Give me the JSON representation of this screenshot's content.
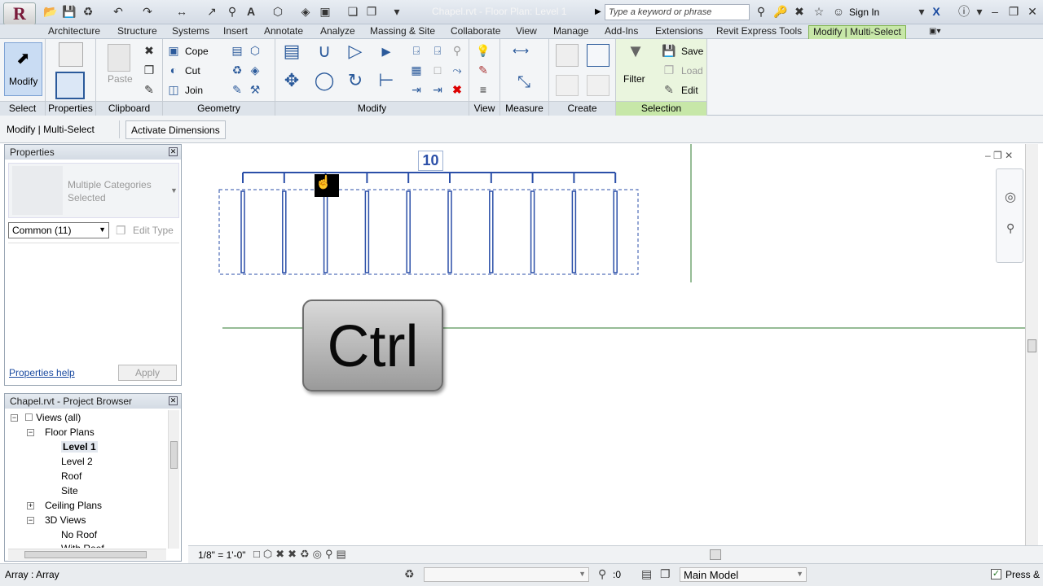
{
  "app": {
    "logo": "R",
    "document_title": "Chapel.rvt - Floor Plan: Level 1",
    "search_placeholder": "Type a keyword or phrase",
    "sign_in": "Sign In"
  },
  "tabs": [
    "Architecture",
    "Structure",
    "Systems",
    "Insert",
    "Annotate",
    "Analyze",
    "Massing & Site",
    "Collaborate",
    "View",
    "Manage",
    "Add-Ins",
    "Extensions",
    "Revit Express Tools",
    "Modify | Multi-Select"
  ],
  "ribbon": {
    "panels": {
      "select": "Select",
      "properties": "Properties",
      "clipboard": "Clipboard",
      "geometry": "Geometry",
      "modify": "Modify",
      "view": "View",
      "measure": "Measure",
      "create": "Create",
      "selection": "Selection"
    },
    "modify_label": "Modify",
    "paste_label": "Paste",
    "cope_label": "Cope",
    "cut_label": "Cut",
    "join_label": "Join",
    "filter_label": "Filter",
    "save_label": "Save",
    "load_label": "Load",
    "edit_label": "Edit"
  },
  "modebar": {
    "context": "Modify | Multi-Select",
    "activate_dimensions": "Activate Dimensions"
  },
  "properties": {
    "title": "Properties",
    "type_text": "Multiple Categories Selected",
    "filter_value": "Common (11)",
    "edit_type": "Edit Type",
    "help_link": "Properties help",
    "apply": "Apply"
  },
  "browser": {
    "title": "Chapel.rvt - Project Browser",
    "items": {
      "views_all": "Views (all)",
      "floor_plans": "Floor Plans",
      "level1": "Level 1",
      "level2": "Level 2",
      "roof": "Roof",
      "site": "Site",
      "ceiling_plans": "Ceiling Plans",
      "views_3d": "3D Views",
      "no_roof": "No Roof",
      "with_roof": "With Roof"
    }
  },
  "canvas": {
    "array_count": "10",
    "overlay_key": "Ctrl"
  },
  "viewbar": {
    "scale": "1/8\" = 1'-0\""
  },
  "status": {
    "text": "Array : Array",
    "selection_count": ":0",
    "workset": "Main Model",
    "press_drag": "Press &"
  },
  "colors": {
    "accent_tab": "#c7e7a8",
    "selection_blue": "#2b4fa8",
    "grid_green": "#2d7a2d"
  }
}
